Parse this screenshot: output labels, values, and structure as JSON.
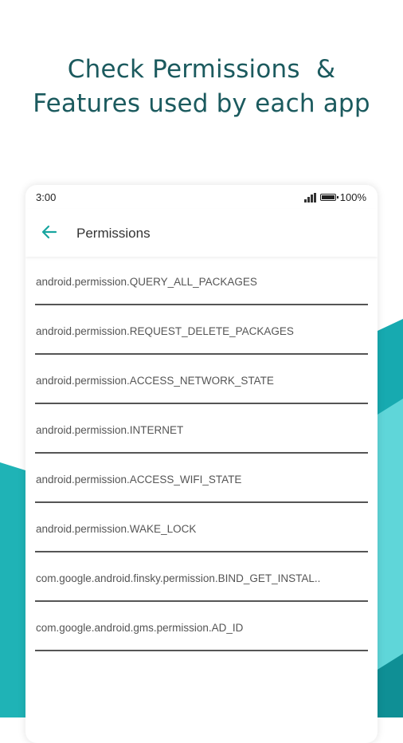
{
  "headline": {
    "line1": "Check Permissions  &",
    "line2": "Features used by each app"
  },
  "colors": {
    "headline": "#1b5a5e",
    "accent": "#18a59f",
    "teal_light": "#5fd6d9",
    "teal_dark": "#0f8f95"
  },
  "status_bar": {
    "time": "3:00",
    "battery": "100%"
  },
  "app_bar": {
    "back_icon": "arrow-left-icon",
    "title": "Permissions"
  },
  "permissions": [
    "android.permission.QUERY_ALL_PACKAGES",
    "android.permission.REQUEST_DELETE_PACKAGES",
    "android.permission.ACCESS_NETWORK_STATE",
    "android.permission.INTERNET",
    "android.permission.ACCESS_WIFI_STATE",
    "android.permission.WAKE_LOCK",
    "com.google.android.finsky.permission.BIND_GET_INSTAL..",
    "com.google.android.gms.permission.AD_ID"
  ]
}
